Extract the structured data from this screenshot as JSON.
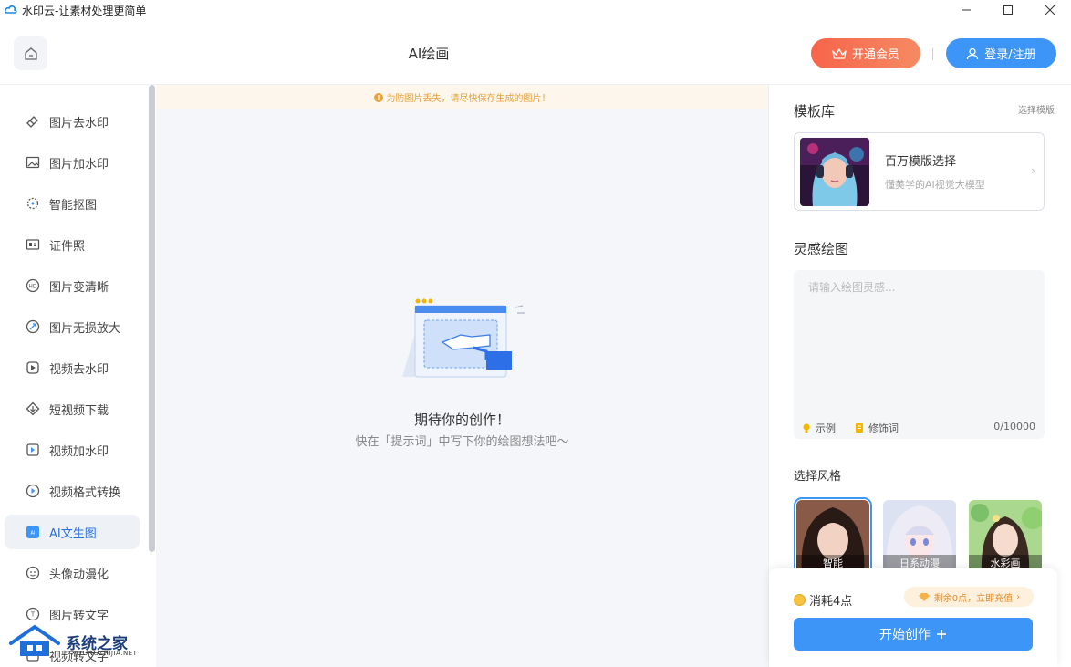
{
  "window": {
    "title": "水印云-让素材处理更简单",
    "icons": [
      "app-cloud-icon",
      "minimize-icon",
      "maximize-icon",
      "close-icon"
    ]
  },
  "header": {
    "page_title": "AI绘画",
    "vip_label": "开通会员",
    "login_label": "登录/注册"
  },
  "sidebar": {
    "items": [
      {
        "label": "图片去水印",
        "icon": "eraser-icon"
      },
      {
        "label": "图片加水印",
        "icon": "image-add-icon"
      },
      {
        "label": "智能抠图",
        "icon": "cutout-icon"
      },
      {
        "label": "证件照",
        "icon": "id-card-icon"
      },
      {
        "label": "图片变清晰",
        "icon": "hd-icon"
      },
      {
        "label": "图片无损放大",
        "icon": "enlarge-icon"
      },
      {
        "label": "视频去水印",
        "icon": "video-eraser-icon"
      },
      {
        "label": "短视频下载",
        "icon": "download-icon"
      },
      {
        "label": "视频加水印",
        "icon": "video-add-icon"
      },
      {
        "label": "视频格式转换",
        "icon": "convert-icon"
      },
      {
        "label": "AI文生图",
        "icon": "ai-image-icon",
        "active": true
      },
      {
        "label": "头像动漫化",
        "icon": "avatar-anime-icon"
      },
      {
        "label": "图片转文字",
        "icon": "image-text-icon"
      },
      {
        "label": "视频转文字",
        "icon": "video-text-icon"
      }
    ],
    "watermark": {
      "text": "系统之家",
      "sub": "XITONGZHIJIA.NET"
    }
  },
  "main": {
    "notice": "为防图片丢失，请尽快保存生成的图片！",
    "empty_title": "期待你的创作！",
    "empty_subtitle": "快在「提示词」中写下你的绘图想法吧～"
  },
  "panel": {
    "template_title": "模板库",
    "template_link": "选择模版",
    "template_card": {
      "name": "百万模版选择",
      "desc": "懂美学的AI视觉大模型"
    },
    "inspiration_title": "灵感绘图",
    "prompt_placeholder": "请输入绘图灵感...",
    "example_label": "示例",
    "modifier_label": "修饰词",
    "char_count": "0/10000",
    "style_title": "选择风格",
    "styles": [
      {
        "label": "智能",
        "selected": true
      },
      {
        "label": "日系动漫",
        "selected": false
      },
      {
        "label": "水彩画",
        "selected": false
      }
    ],
    "cost_label": "消耗4点",
    "balance_label": "剩余0点，立即充值",
    "start_label": "开始创作"
  },
  "colors": {
    "primary": "#3d95f7",
    "vip": "#f7644a",
    "notice": "#e6a23c",
    "active_text": "#2a6fe0"
  }
}
